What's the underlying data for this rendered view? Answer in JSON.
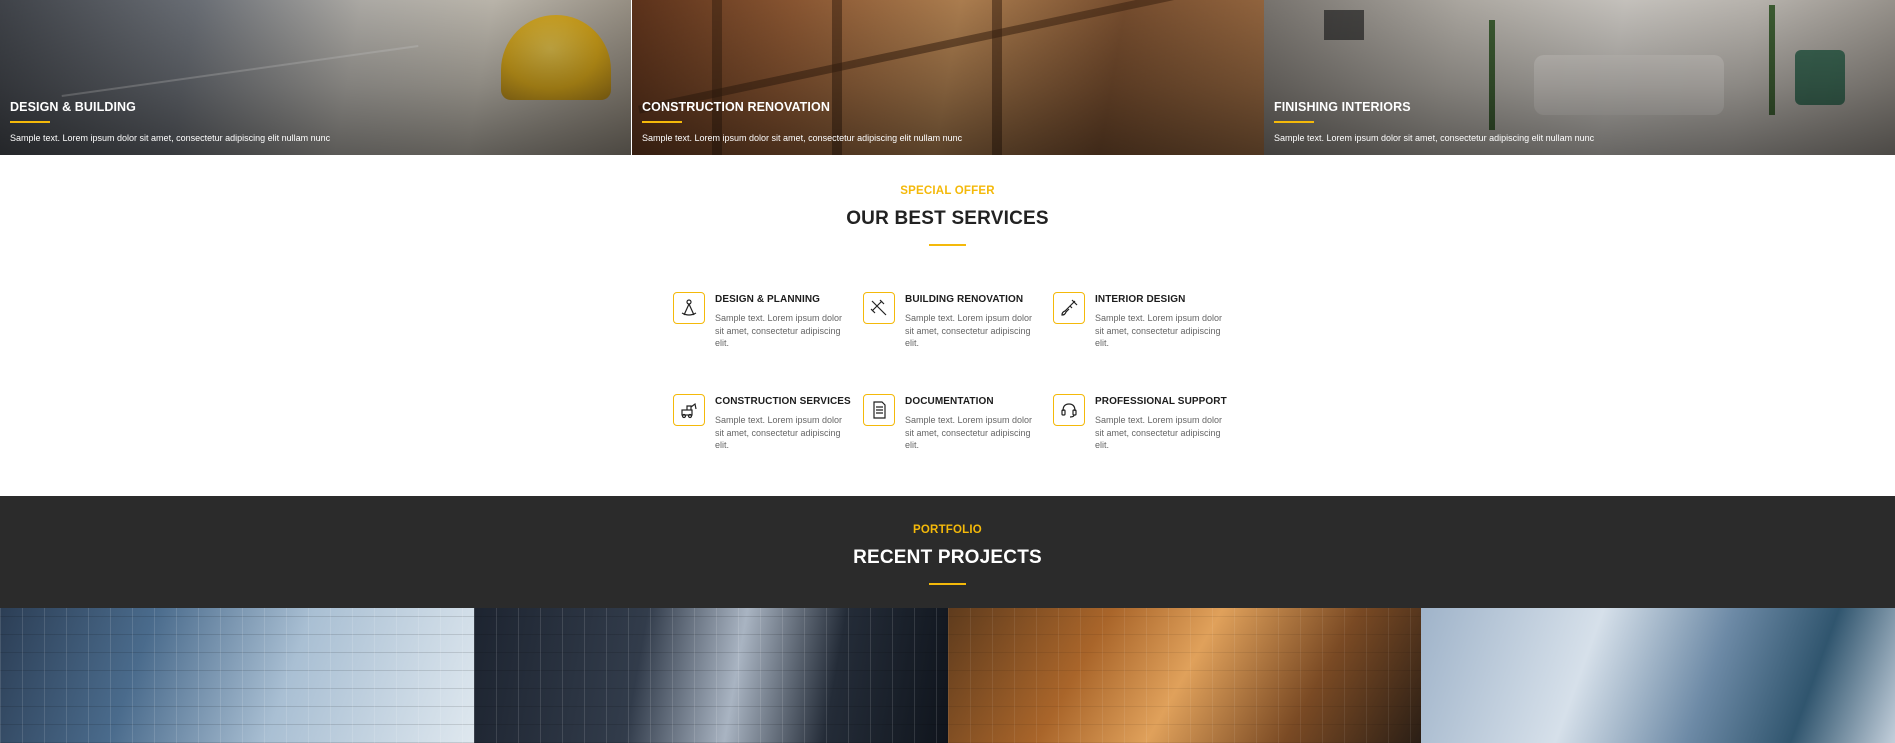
{
  "top_tiles": [
    {
      "title": "DESIGN & BUILDING",
      "text": "Sample text. Lorem ipsum dolor sit amet, consectetur adipiscing elit nullam nunc"
    },
    {
      "title": "CONSTRUCTION RENOVATION",
      "text": "Sample text. Lorem ipsum dolor sit amet, consectetur adipiscing elit nullam nunc"
    },
    {
      "title": "FINISHING INTERIORS",
      "text": "Sample text. Lorem ipsum dolor sit amet, consectetur adipiscing elit nullam nunc"
    }
  ],
  "services": {
    "eyebrow": "SPECIAL OFFER",
    "title": "OUR BEST SERVICES",
    "items": [
      {
        "title": "DESIGN & PLANNING",
        "text": "Sample text. Lorem ipsum dolor sit amet, consectetur adipiscing elit.",
        "icon": "compass-drafting-icon"
      },
      {
        "title": "BUILDING RENOVATION",
        "text": "Sample text. Lorem ipsum dolor sit amet, consectetur adipiscing elit.",
        "icon": "hammer-wrench-icon"
      },
      {
        "title": "INTERIOR DESIGN",
        "text": "Sample text. Lorem ipsum dolor sit amet, consectetur adipiscing elit.",
        "icon": "paint-brush-icon"
      },
      {
        "title": "CONSTRUCTION SERVICES",
        "text": "Sample text. Lorem ipsum dolor sit amet, consectetur adipiscing elit.",
        "icon": "excavator-icon"
      },
      {
        "title": "DOCUMENTATION",
        "text": "Sample text. Lorem ipsum dolor sit amet, consectetur adipiscing elit.",
        "icon": "document-icon"
      },
      {
        "title": "PROFESSIONAL SUPPORT",
        "text": "Sample text. Lorem ipsum dolor sit amet, consectetur adipiscing elit.",
        "icon": "headset-icon"
      }
    ]
  },
  "portfolio": {
    "eyebrow": "PORTFOLIO",
    "title": "RECENT PROJECTS"
  },
  "colors": {
    "accent": "#f4b90a",
    "dark_band": "#2b2b2b"
  }
}
